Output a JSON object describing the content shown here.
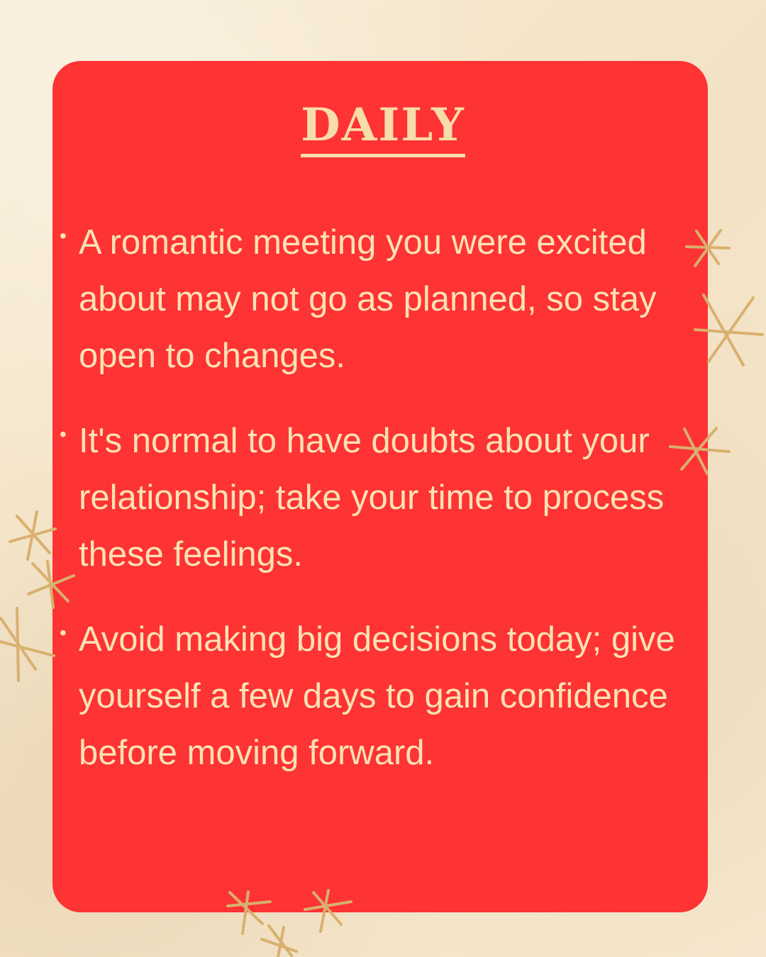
{
  "title": "DAILY",
  "items": [
    {
      "bullet": "•",
      "text": "A romantic meeting you were excited about may not go as planned, so stay open to changes."
    },
    {
      "bullet": "•",
      "text": "It's normal to have doubts about your relationship; take your time to process these feelings."
    },
    {
      "bullet": "•",
      "text": "Avoid making big decisions today; give yourself a few days to gain confidence before moving forward."
    }
  ],
  "colors": {
    "background": "#f6e8cf",
    "card": "#fe3333",
    "text": "#fbe2b6",
    "sparkles": "#d9b06e"
  },
  "decorations": {
    "sparkle_icon": "sparkle-icon"
  }
}
